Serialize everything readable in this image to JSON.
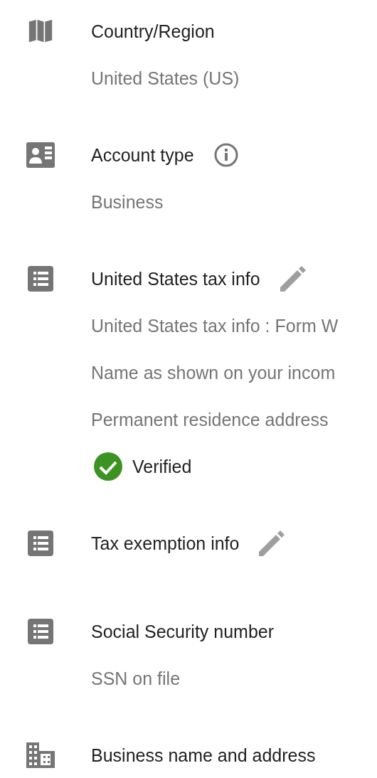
{
  "sections": [
    {
      "kind": "region",
      "title": "Country/Region",
      "values": [
        "United States (US)"
      ]
    },
    {
      "kind": "account",
      "title": "Account type",
      "has_info": true,
      "values": [
        "Business"
      ]
    },
    {
      "kind": "tax",
      "title": "United States tax info",
      "editable": true,
      "values": [
        "United States tax info : Form W",
        "Name as shown on your incom",
        "Permanent residence address"
      ],
      "status": {
        "text": "Verified",
        "verified": true
      }
    },
    {
      "kind": "tax",
      "title": "Tax exemption info",
      "editable": true
    },
    {
      "kind": "tax",
      "title": "Social Security number",
      "values": [
        "SSN on file"
      ]
    },
    {
      "kind": "business",
      "title": "Business name and address"
    }
  ]
}
